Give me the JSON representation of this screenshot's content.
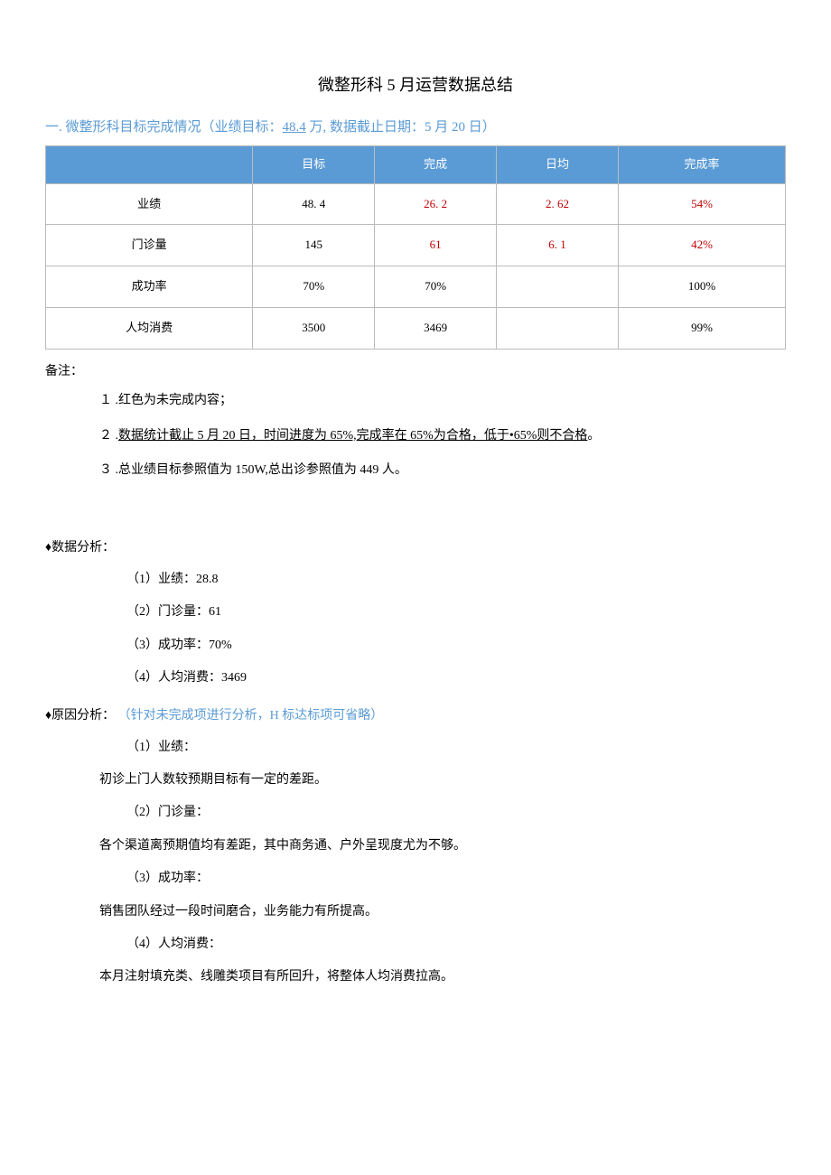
{
  "title": "微整形科 5 月运营数据总结",
  "section1": {
    "prefix": "一. 微整形科目标完成情况（业绩目标：",
    "target_amount": "48.4",
    "mid": " 万, 数据截止日期：5 月 20 日）"
  },
  "table": {
    "headers": [
      "",
      "目标",
      "完成",
      "日均",
      "完成率"
    ],
    "rows": [
      {
        "label": "业绩",
        "target": "48. 4",
        "done": "26. 2",
        "daily": "2. 62",
        "rate": "54%",
        "red": true
      },
      {
        "label": "门诊量",
        "target": "145",
        "done": "61",
        "daily": "6. 1",
        "rate": "42%",
        "red": true
      },
      {
        "label": "成功率",
        "target": "70%",
        "done": "70%",
        "daily": "",
        "rate": "100%",
        "red": false
      },
      {
        "label": "人均消费",
        "target": "3500",
        "done": "3469",
        "daily": "",
        "rate": "99%",
        "red": false
      }
    ]
  },
  "note_label": "备注：",
  "notes": {
    "n1": "１ .红色为未完成内容；",
    "n2a": "２ .",
    "n2b": "数据统计截止 5 月 20 日，时间进度为 65%,",
    "n2c": "完成率在 65%为合格，低于•65%则不合格",
    "n2d": "。",
    "n3": "３ .总业绩目标参照值为 150W,总出诊参照值为 449 人。"
  },
  "data_analysis": {
    "heading": "♦数据分析：",
    "i1": "（1）业绩：28.8",
    "i2": "（2）门诊量：61",
    "i3": "（3）成功率：70%",
    "i4": "（4）人均消费：3469"
  },
  "cause": {
    "heading": "♦原因分析：",
    "hint": "（针对未完成项进行分析，H 标达标项可省略）",
    "h1": "（1）业绩：",
    "p1": "初诊上门人数较预期目标有一定的差距。",
    "h2": "（2）门诊量：",
    "p2": "各个渠道离预期值均有差距，其中商务通、户外呈现度尤为不够。",
    "h3": "（3）成功率：",
    "p3": "销售团队经过一段时间磨合，业务能力有所提高。",
    "h4": "（4）人均消费：",
    "p4": "本月注射填充类、线雕类项目有所回升，将整体人均消费拉高。"
  }
}
